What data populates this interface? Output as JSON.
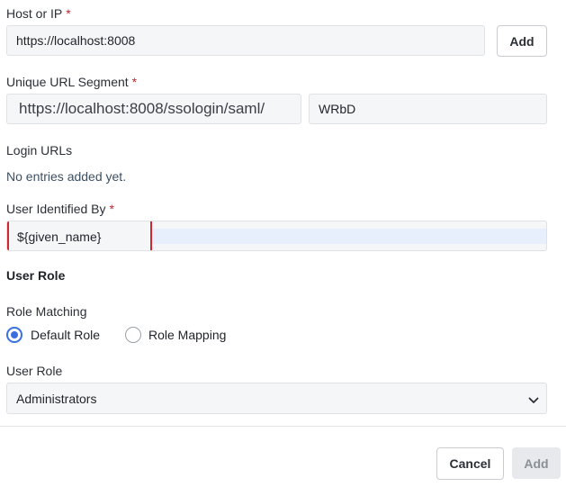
{
  "host": {
    "label": "Host or IP",
    "required_mark": "*",
    "value": "https://localhost:8008",
    "add_button": "Add"
  },
  "url_segment": {
    "label": "Unique URL Segment",
    "required_mark": "*",
    "prefix": "https://localhost:8008/ssologin/saml/",
    "value": "WRbD"
  },
  "login_urls": {
    "label": "Login URLs",
    "empty_text": "No entries added yet."
  },
  "user_identified": {
    "label": "User Identified By",
    "required_mark": "*",
    "value": "${given_name}"
  },
  "user_role_section": {
    "heading": "User Role",
    "role_matching_label": "Role Matching",
    "options": [
      {
        "label": "Default Role",
        "selected": true
      },
      {
        "label": "Role Mapping",
        "selected": false
      }
    ],
    "user_role_label": "User Role",
    "user_role_value": "Administrators"
  },
  "footer": {
    "cancel_button": "Cancel",
    "add_button": "Add"
  },
  "colors": {
    "accent": "#3b6fe0",
    "required": "#c0262d",
    "highlight_border": "#d0272d",
    "selection_bg": "#e8effc"
  }
}
